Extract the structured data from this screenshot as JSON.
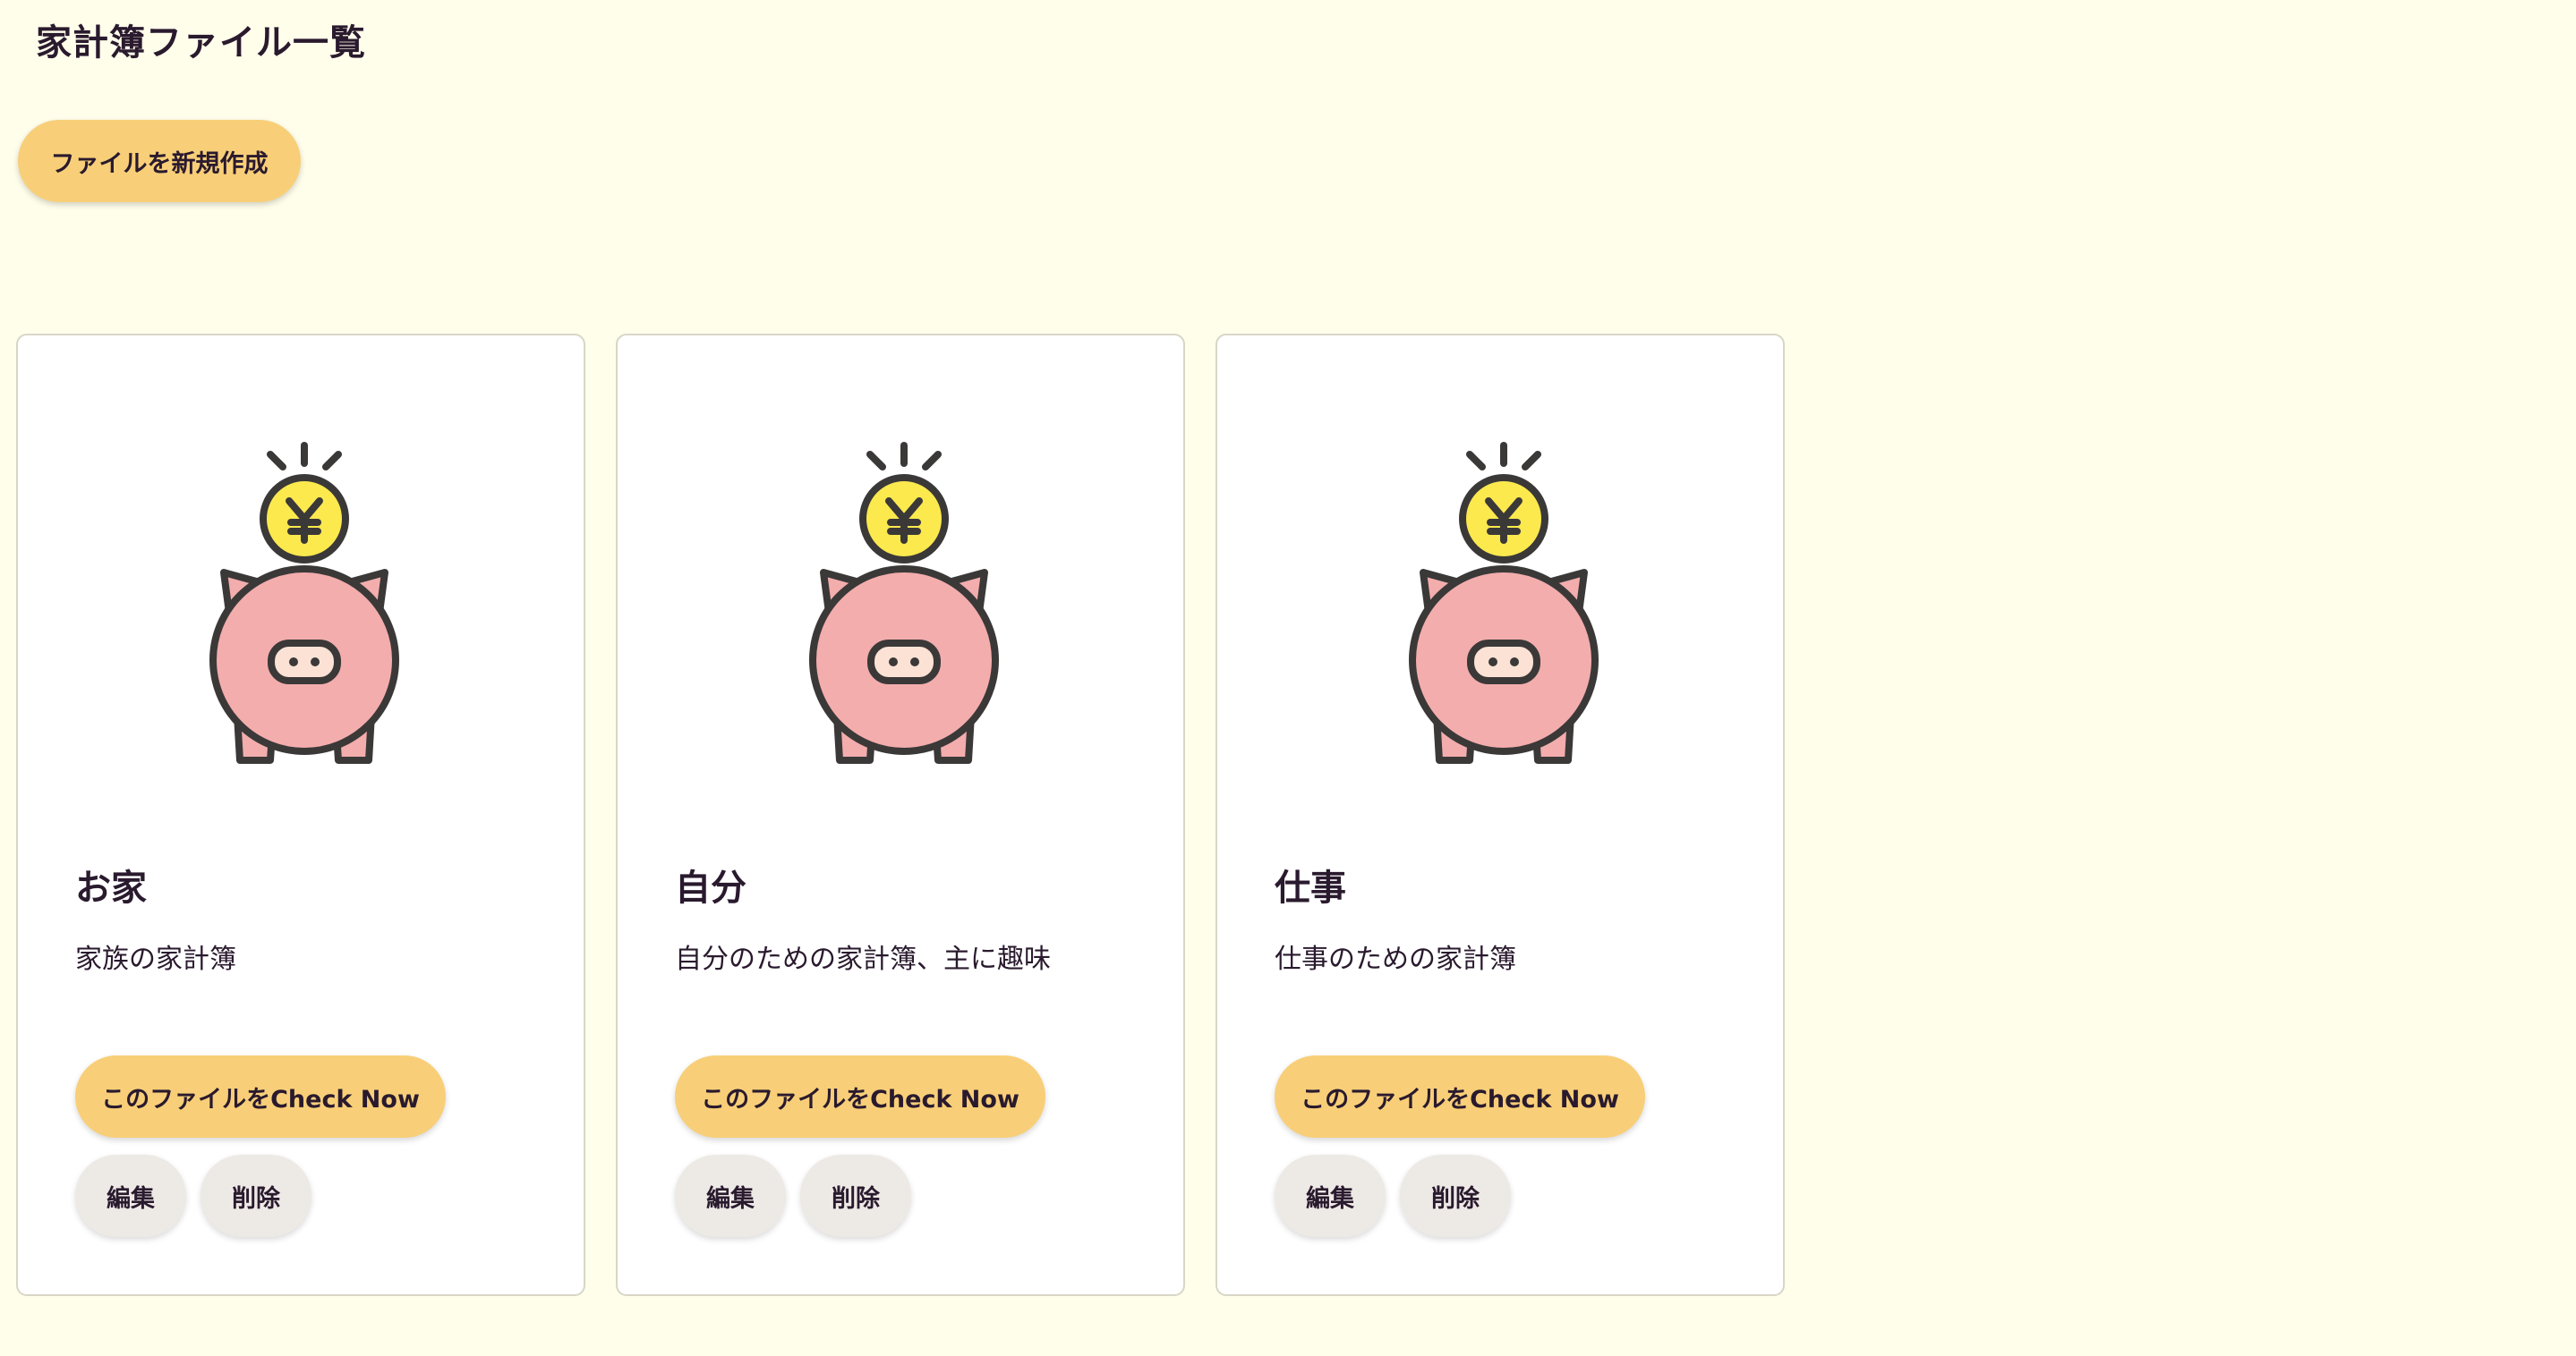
{
  "page": {
    "title": "家計簿ファイル一覧",
    "background_color": "#fffeeb"
  },
  "toolbar": {
    "new_file_label": "ファイルを新規作成"
  },
  "colors": {
    "primary_button": "#f8cf78",
    "secondary_button": "#edeae6",
    "pig": "#f3adad",
    "coin": "#fbe94e",
    "outline": "#3b3838"
  },
  "card_image_icon": "piggy-bank-with-yen-coin",
  "cards": [
    {
      "title": "お家",
      "description": "家族の家計簿",
      "check_label": "このファイルをCheck Now",
      "edit_label": "編集",
      "delete_label": "削除"
    },
    {
      "title": "自分",
      "description": "自分のための家計簿、主に趣味",
      "check_label": "このファイルをCheck Now",
      "edit_label": "編集",
      "delete_label": "削除"
    },
    {
      "title": "仕事",
      "description": "仕事のための家計簿",
      "check_label": "このファイルをCheck Now",
      "edit_label": "編集",
      "delete_label": "削除"
    }
  ]
}
